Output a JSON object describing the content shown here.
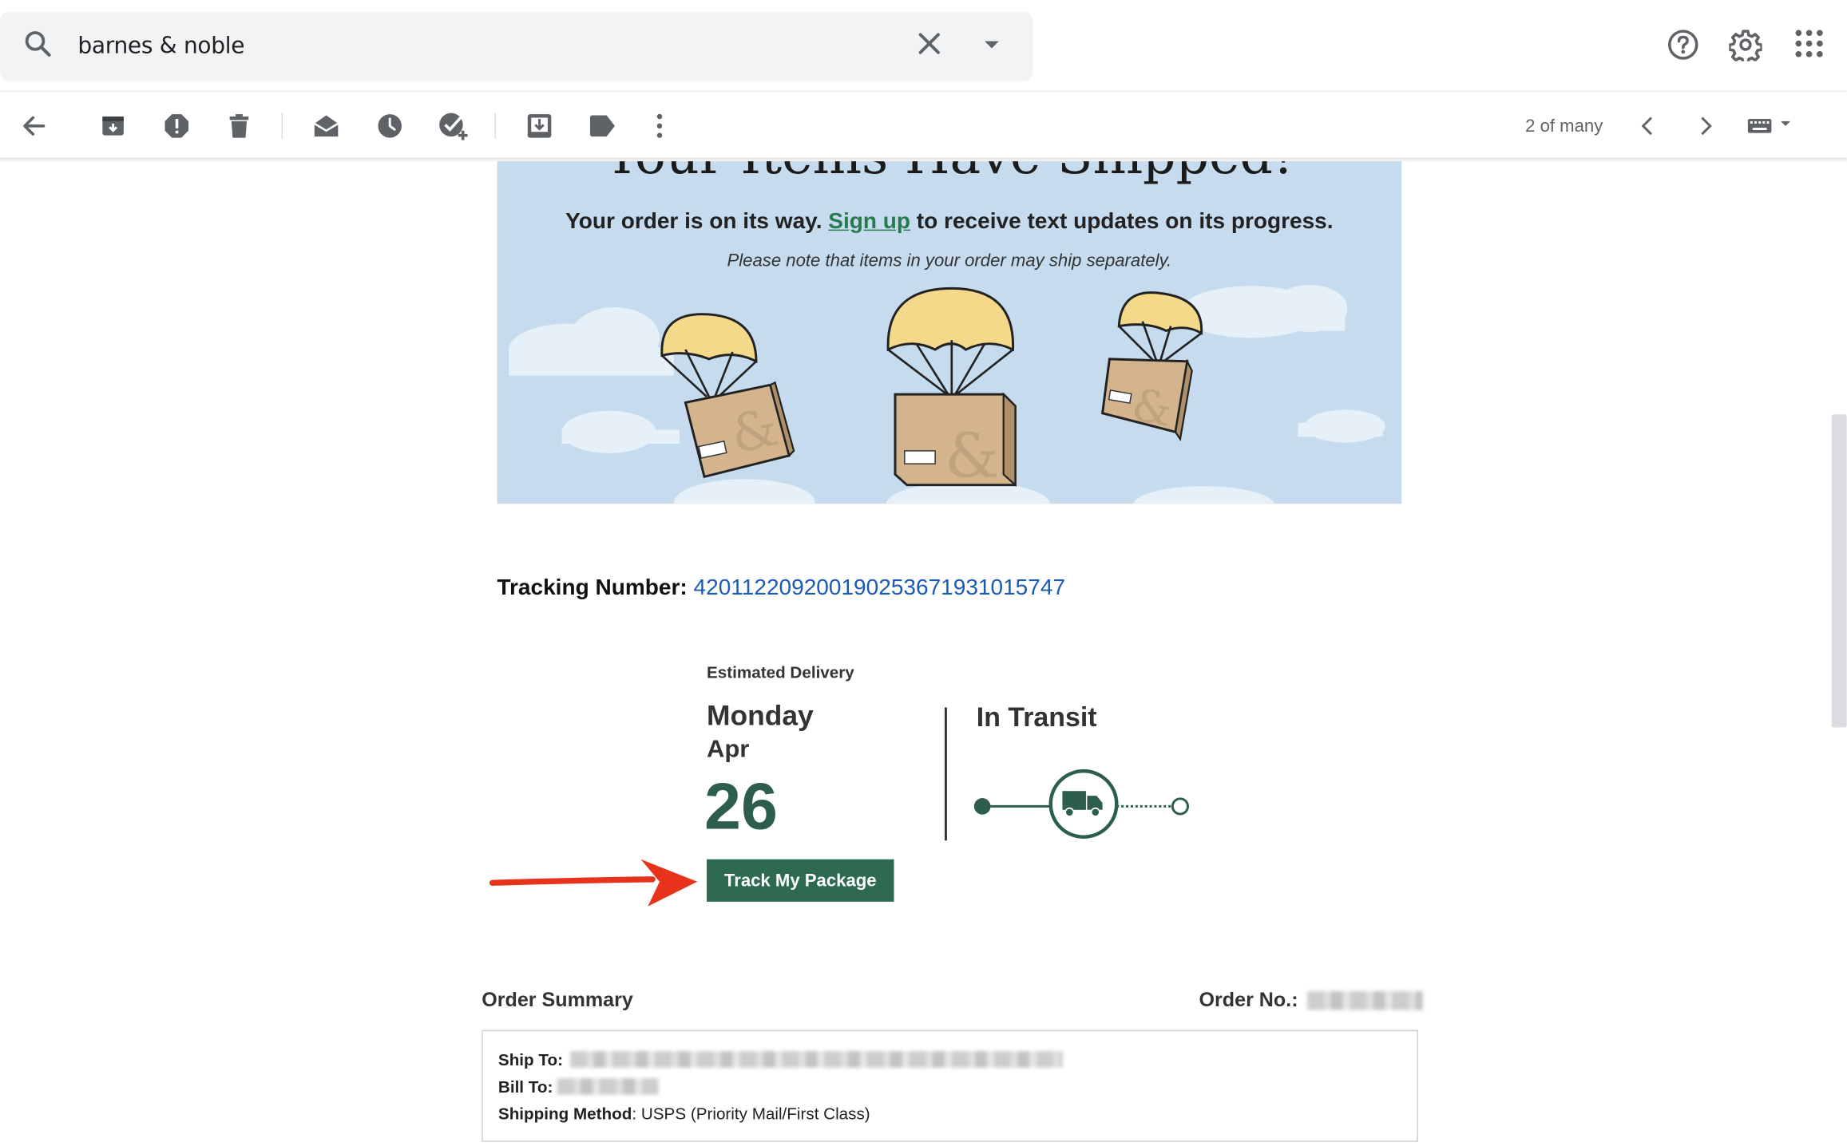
{
  "search": {
    "query": "barnes & noble"
  },
  "toolbar": {
    "icons": [
      "back-arrow-icon",
      "archive-icon",
      "report-spam-icon",
      "delete-icon",
      "mark-unread-icon",
      "snooze-icon",
      "add-task-icon",
      "move-to-icon",
      "label-icon",
      "more-icon"
    ],
    "pager": "2 of many"
  },
  "email": {
    "banner_title": "Your Items Have Shipped!",
    "intro_before": "Your order is on its way.",
    "intro_link": "Sign up",
    "intro_after": "to receive text updates on its progress.",
    "note": "Please note that items in your order may ship separately.",
    "tracking_label": "Tracking Number:",
    "tracking_number": "420112209200190253671931015747",
    "estimated_label": "Estimated Delivery",
    "weekday": "Monday",
    "month": "Apr",
    "day": "26",
    "status": "In Transit",
    "track_button": "Track My Package",
    "order_summary": "Order Summary",
    "order_no_label": "Order No.:",
    "ship_to_label": "Ship To:",
    "bill_to_label": "Bill To:",
    "shipping_method_label": "Shipping Method",
    "shipping_method_value": ": USPS (Priority Mail/First Class)"
  },
  "colors": {
    "brand_green": "#2e6a52",
    "banner_bg": "#c6dcee",
    "link_blue": "#1a5ab2",
    "annotation_red": "#e8331c"
  }
}
